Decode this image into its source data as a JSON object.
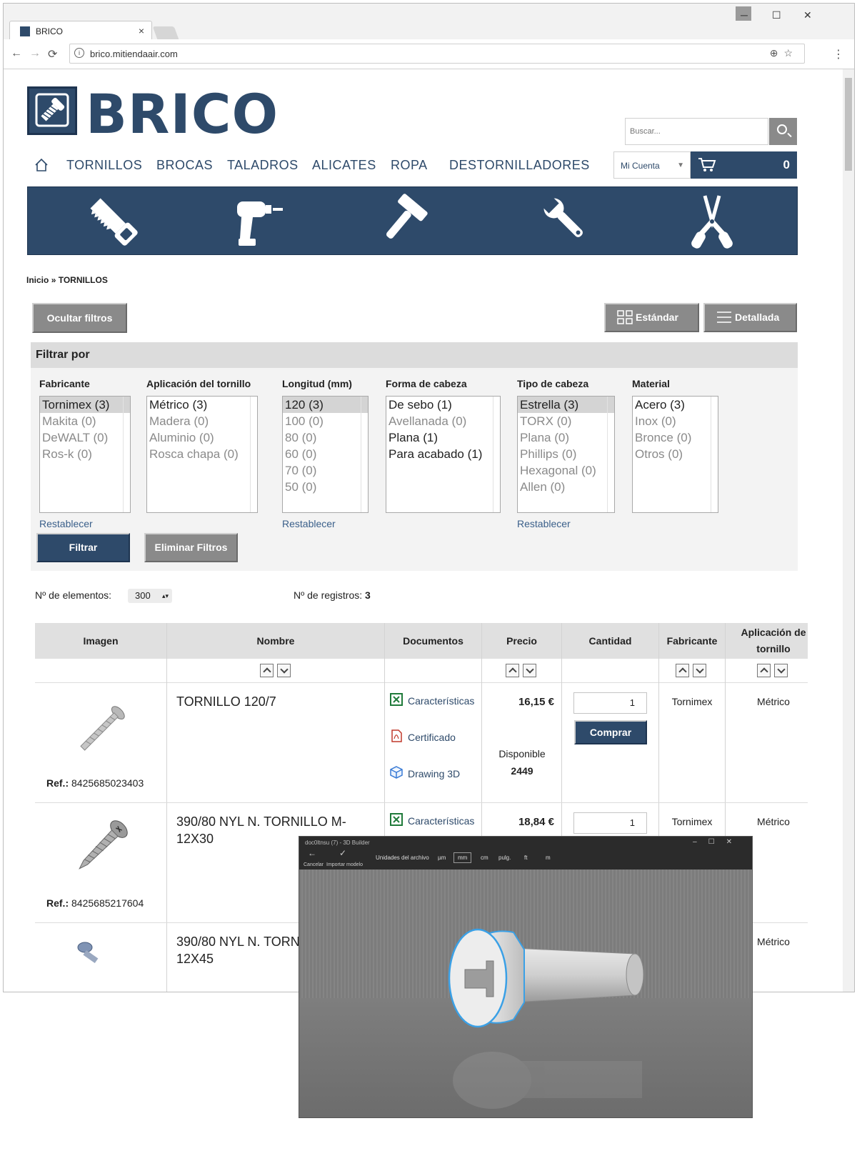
{
  "browser": {
    "tab_title": "BRICO",
    "tab_close": "×",
    "url": "brico.mitiendaair.com",
    "minimize": "─",
    "maximize": "☐",
    "close": "✕",
    "back": "←",
    "forward": "→",
    "reload": "⟳",
    "url_info": "i",
    "url_icons": "⊕☆",
    "menu": "⋮"
  },
  "header": {
    "logo_text": "BRICO",
    "search_placeholder": "Buscar...",
    "account_label": "Mi Cuenta",
    "account_caret": "▼",
    "cart_count": "0"
  },
  "nav": {
    "items": [
      "TORNILLOS",
      "BROCAS",
      "TALADROS",
      "ALICATES",
      "ROPA",
      "DESTORNILLADORES"
    ]
  },
  "banner": {
    "icons": [
      "saw-icon",
      "drill-icon",
      "hammer-icon",
      "wrench-icon",
      "pliers-icon"
    ]
  },
  "breadcrumb": {
    "home": "Inicio",
    "separator": "»",
    "current": "TORNILLOS"
  },
  "toolbar": {
    "hide_filters": "Ocultar filtros",
    "view_standard": "Estándar",
    "view_detailed": "Detallada"
  },
  "filters": {
    "title": "Filtrar por",
    "facets": [
      {
        "title": "Fabricante",
        "options": [
          "Tornimex (3)",
          "Makita (0)",
          "DeWALT (0)",
          "Ros-k (0)"
        ],
        "selected": 0,
        "reset": "Restablecer"
      },
      {
        "title": "Aplicación del tornillo",
        "options": [
          "Métrico (3)",
          "Madera (0)",
          "Aluminio (0)",
          "Rosca chapa (0)"
        ],
        "selected": -1,
        "reset": ""
      },
      {
        "title": "Longitud (mm)",
        "options": [
          "120 (3)",
          "100 (0)",
          "80 (0)",
          "60 (0)",
          "70 (0)",
          "50 (0)"
        ],
        "selected": 0,
        "reset": "Restablecer"
      },
      {
        "title": "Forma de cabeza",
        "options": [
          "De sebo (1)",
          "Avellanada (0)",
          "Plana (1)",
          "Para acabado (1)"
        ],
        "selected": -1,
        "reset": ""
      },
      {
        "title": "Tipo de cabeza",
        "options": [
          "Estrella (3)",
          "TORX (0)",
          "Plana (0)",
          "Phillips (0)",
          "Hexagonal (0)",
          "Allen (0)"
        ],
        "selected": 0,
        "reset": "Restablecer"
      },
      {
        "title": "Material",
        "options": [
          "Acero (3)",
          "Inox (0)",
          "Bronce (0)",
          "Otros (0)"
        ],
        "selected": -1,
        "reset": ""
      }
    ],
    "filter_button": "Filtrar",
    "clear_button": "Eliminar Filtros"
  },
  "listing": {
    "per_page_label": "Nº de elementos:",
    "per_page_value": "300",
    "per_page_caret": "▴▾",
    "records_label": "Nº de registros:",
    "records_value": "3"
  },
  "table": {
    "columns": [
      "Imagen",
      "Nombre",
      "Documentos",
      "Precio",
      "Cantidad",
      "Fabricante",
      "Aplicación de tornillo"
    ],
    "ref_label": "Ref.:",
    "buy_label": "Comprar",
    "rows": [
      {
        "name": "TORNILLO 120/7",
        "ref": "8425685023403",
        "docs": [
          "Características",
          "Certificado",
          "Drawing 3D"
        ],
        "price": "16,15 €",
        "avail_label": "Disponible",
        "avail_qty": "2449",
        "qty": "1",
        "maker": "Tornimex",
        "application": "Métrico"
      },
      {
        "name": "390/80 NYL N. TORNILLO M-12X30",
        "ref": "8425685217604",
        "docs": [
          "Características"
        ],
        "price": "18,84 €",
        "avail_label": "",
        "avail_qty": "",
        "qty": "1",
        "maker": "Tornimex",
        "application": "Métrico"
      },
      {
        "name": "390/80 NYL N. TORNILLO M-12X45",
        "ref": "",
        "docs": [],
        "price": "",
        "avail_label": "",
        "avail_qty": "",
        "qty": "",
        "maker": "",
        "application": "Métrico"
      }
    ]
  },
  "builder": {
    "title": "doc0ltnsu (7) - 3D Builder",
    "winctl": "–☐✕",
    "cancel": "Cancelar",
    "import": "Importar modelo",
    "units_label": "Unidades del archivo",
    "units": [
      "µm",
      "mm",
      "cm",
      "pulg.",
      "ft",
      "m"
    ],
    "selected_unit": "mm"
  }
}
